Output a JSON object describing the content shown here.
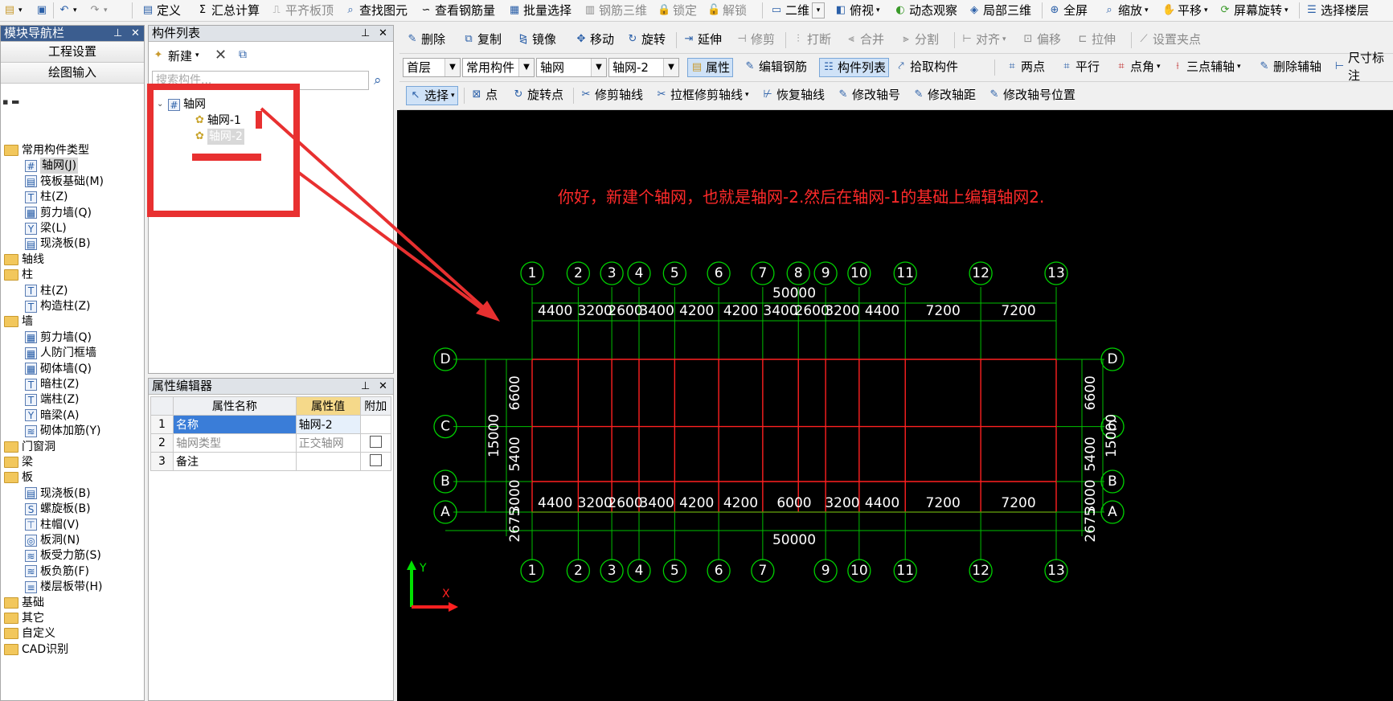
{
  "toolbar": {
    "items": [
      "定义",
      "汇总计算",
      "平齐板顶",
      "查找图元",
      "查看钢筋量",
      "批量选择",
      "钢筋三维",
      "锁定",
      "解锁",
      "二维",
      "俯视",
      "动态观察",
      "局部三维",
      "全屏",
      "缩放",
      "平移",
      "屏幕旋转",
      "选择楼层"
    ]
  },
  "nav": {
    "title": "模块导航栏",
    "btn_project": "工程设置",
    "btn_draw": "绘图输入",
    "tree": [
      {
        "label": "常用构件类型",
        "level": 0,
        "folder": true,
        "open": true
      },
      {
        "label": "轴网(J)",
        "level": 1,
        "icon": "grid",
        "selected": true
      },
      {
        "label": "筏板基础(M)",
        "level": 1,
        "icon": "slab"
      },
      {
        "label": "柱(Z)",
        "level": 1,
        "icon": "column"
      },
      {
        "label": "剪力墙(Q)",
        "level": 1,
        "icon": "wall"
      },
      {
        "label": "梁(L)",
        "level": 1,
        "icon": "beam"
      },
      {
        "label": "现浇板(B)",
        "level": 1,
        "icon": "slab"
      },
      {
        "label": "轴线",
        "level": 0,
        "folder": true
      },
      {
        "label": "柱",
        "level": 0,
        "folder": true,
        "open": true
      },
      {
        "label": "柱(Z)",
        "level": 1,
        "icon": "column"
      },
      {
        "label": "构造柱(Z)",
        "level": 1,
        "icon": "column"
      },
      {
        "label": "墙",
        "level": 0,
        "folder": true,
        "open": true
      },
      {
        "label": "剪力墙(Q)",
        "level": 1,
        "icon": "wall"
      },
      {
        "label": "人防门框墙",
        "level": 1,
        "icon": "wall"
      },
      {
        "label": "砌体墙(Q)",
        "level": 1,
        "icon": "wall"
      },
      {
        "label": "暗柱(Z)",
        "level": 1,
        "icon": "column"
      },
      {
        "label": "端柱(Z)",
        "level": 1,
        "icon": "column"
      },
      {
        "label": "暗梁(A)",
        "level": 1,
        "icon": "beam"
      },
      {
        "label": "砌体加筋(Y)",
        "level": 1,
        "icon": "rebar"
      },
      {
        "label": "门窗洞",
        "level": 0,
        "folder": true
      },
      {
        "label": "梁",
        "level": 0,
        "folder": true
      },
      {
        "label": "板",
        "level": 0,
        "folder": true,
        "open": true
      },
      {
        "label": "现浇板(B)",
        "level": 1,
        "icon": "slab"
      },
      {
        "label": "螺旋板(B)",
        "level": 1,
        "icon": "spiral"
      },
      {
        "label": "柱帽(V)",
        "level": 1,
        "icon": "cap"
      },
      {
        "label": "板洞(N)",
        "level": 1,
        "icon": "hole"
      },
      {
        "label": "板受力筋(S)",
        "level": 1,
        "icon": "rebar"
      },
      {
        "label": "板负筋(F)",
        "level": 1,
        "icon": "rebar"
      },
      {
        "label": "楼层板带(H)",
        "level": 1,
        "icon": "band"
      },
      {
        "label": "基础",
        "level": 0,
        "folder": true
      },
      {
        "label": "其它",
        "level": 0,
        "folder": true
      },
      {
        "label": "自定义",
        "level": 0,
        "folder": true
      },
      {
        "label": "CAD识别",
        "level": 0,
        "folder": true
      }
    ]
  },
  "component_list": {
    "title": "构件列表",
    "new_label": "新建",
    "search_placeholder": "搜索构件...",
    "root": "轴网",
    "items": [
      "轴网-1",
      "轴网-2"
    ]
  },
  "property_editor": {
    "title": "属性编辑器",
    "headers": [
      "属性名称",
      "属性值",
      "附加"
    ],
    "rows": [
      {
        "no": "1",
        "name": "名称",
        "value": "轴网-2"
      },
      {
        "no": "2",
        "name": "轴网类型",
        "value": "正交轴网"
      },
      {
        "no": "3",
        "name": "备注",
        "value": ""
      }
    ]
  },
  "ribbon1": {
    "items": [
      "删除",
      "复制",
      "镜像",
      "移动",
      "旋转",
      "延伸",
      "修剪",
      "打断",
      "合并",
      "分割",
      "对齐",
      "偏移",
      "拉伸",
      "设置夹点"
    ]
  },
  "ribbon2": {
    "floor": "首层",
    "category": "常用构件",
    "type": "轴网",
    "instance": "轴网-2",
    "items": [
      "属性",
      "编辑钢筋",
      "构件列表",
      "拾取构件",
      "两点",
      "平行",
      "点角",
      "三点辅轴",
      "删除辅轴",
      "尺寸标注"
    ]
  },
  "ribbon3": {
    "items": [
      "选择",
      "点",
      "旋转点",
      "修剪轴线",
      "拉框修剪轴线",
      "恢复轴线",
      "修改轴号",
      "修改轴距",
      "修改轴号位置"
    ]
  },
  "annotation": {
    "text": "你好，新建个轴网，也就是轴网-2.然后在轴网-1的基础上编辑轴网2.",
    "color": "#ff2a2a"
  },
  "drawing": {
    "axes_top": [
      "1",
      "2",
      "3",
      "4",
      "5",
      "6",
      "7",
      "8",
      "9",
      "10",
      "11",
      "12",
      "13"
    ],
    "top_spacing": [
      4400,
      3200,
      2600,
      3400,
      4200,
      4200,
      3400,
      2600,
      3200,
      4400,
      7200,
      7200
    ],
    "axes_bottom": [
      "1",
      "2",
      "3",
      "4",
      "5",
      "6",
      "7",
      "9",
      "10",
      "11",
      "12",
      "13"
    ],
    "bottom_dims": [
      "4400",
      "3200",
      "2600",
      "3400",
      "4200",
      "4200",
      "6000",
      "3200",
      "4400",
      "7200",
      "7200"
    ],
    "total_length": "50000",
    "rows": [
      "D",
      "C",
      "B",
      "A"
    ],
    "row_spacing": [
      6600,
      5400,
      3000
    ],
    "total_height": "15000",
    "offset_dim": "2675",
    "ucs_x": "X",
    "ucs_y": "Y",
    "colors": {
      "axis": "#ff2020",
      "dim": "#00c000",
      "bubble": "#00d000",
      "text": "#ffffff"
    }
  }
}
